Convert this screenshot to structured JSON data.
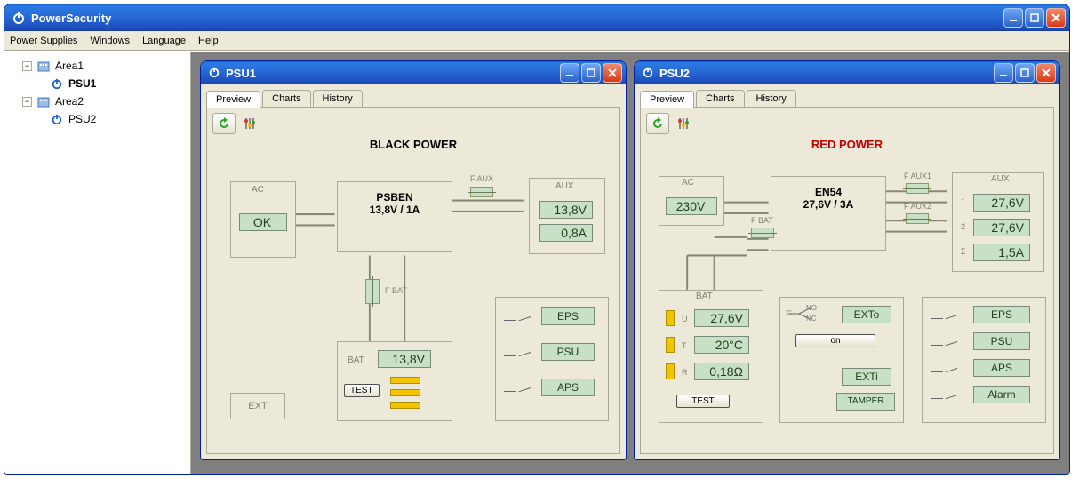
{
  "window": {
    "title": "PowerSecurity"
  },
  "menubar": {
    "items": [
      "Power Supplies",
      "Windows",
      "Language",
      "Help"
    ]
  },
  "tree": {
    "area1": {
      "label": "Area1",
      "psu": "PSU1"
    },
    "area2": {
      "label": "Area2",
      "psu": "PSU2"
    }
  },
  "child_windows": {
    "psu1": {
      "title": "PSU1",
      "tabs": {
        "preview": "Preview",
        "charts": "Charts",
        "history": "History"
      },
      "diagram": {
        "title": "BLACK POWER",
        "ac_label": "AC",
        "ac_value": "OK",
        "model_line1": "PSBEN",
        "model_line2": "13,8V / 1A",
        "f_aux": "F AUX",
        "f_bat": "F BAT",
        "aux_label": "AUX",
        "aux_v": "13,8V",
        "aux_a": "0,8A",
        "bat_label": "BAT",
        "bat_v": "13,8V",
        "test": "TEST",
        "ext_label": "EXT",
        "outputs": {
          "eps": "EPS",
          "psu": "PSU",
          "aps": "APS"
        }
      }
    },
    "psu2": {
      "title": "PSU2",
      "tabs": {
        "preview": "Preview",
        "charts": "Charts",
        "history": "History"
      },
      "diagram": {
        "title": "RED POWER",
        "ac_label": "AC",
        "ac_value": "230V",
        "model_line1": "EN54",
        "model_line2": "27,6V / 3A",
        "f_aux1": "F AUX1",
        "f_aux2": "F AUX2",
        "f_bat": "F BAT",
        "aux_label": "AUX",
        "aux_row1_lbl": "1",
        "aux_row2_lbl": "2",
        "aux_row3_lbl": "Σ",
        "aux_v1": "27,6V",
        "aux_v2": "27,6V",
        "aux_a": "1,5A",
        "bat_label": "BAT",
        "bat_u_lbl": "U",
        "bat_t_lbl": "T",
        "bat_r_lbl": "R",
        "bat_u": "27,6V",
        "bat_t": "20°C",
        "bat_r": "0,18Ω",
        "test": "TEST",
        "exto": "EXTo",
        "on_btn": "on",
        "exti": "EXTi",
        "tamper": "TAMPER",
        "relay_no": "NO",
        "relay_nc": "NC",
        "relay_c": "C",
        "outputs": {
          "eps": "EPS",
          "psu": "PSU",
          "aps": "APS",
          "alarm": "Alarm"
        }
      }
    }
  }
}
